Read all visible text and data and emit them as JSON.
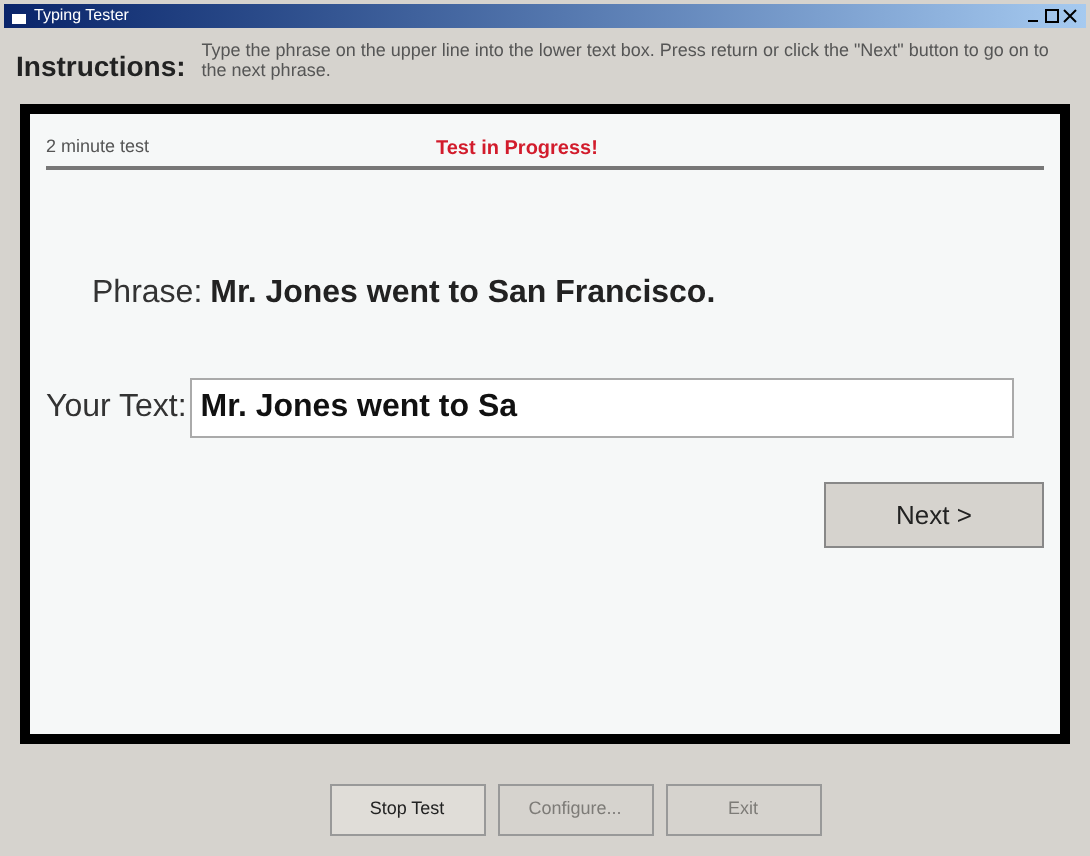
{
  "window": {
    "title": "Typing Tester"
  },
  "instructions": {
    "label": "Instructions:",
    "text": "Type the phrase on the upper line into the lower text box.  Press return or click the \"Next\" button to go on to the next phrase."
  },
  "panel": {
    "test_length": "2 minute test",
    "status": "Test in Progress!",
    "phrase_label": "Phrase:",
    "phrase": "Mr. Jones went to San Francisco.",
    "input_label": "Your Text:",
    "input_value": "Mr. Jones went to Sa",
    "next_button": "Next >"
  },
  "buttons": [
    {
      "label": "Stop Test",
      "disabled": false
    },
    {
      "label": "Configure...",
      "disabled": true
    },
    {
      "label": "Exit",
      "disabled": true
    }
  ]
}
